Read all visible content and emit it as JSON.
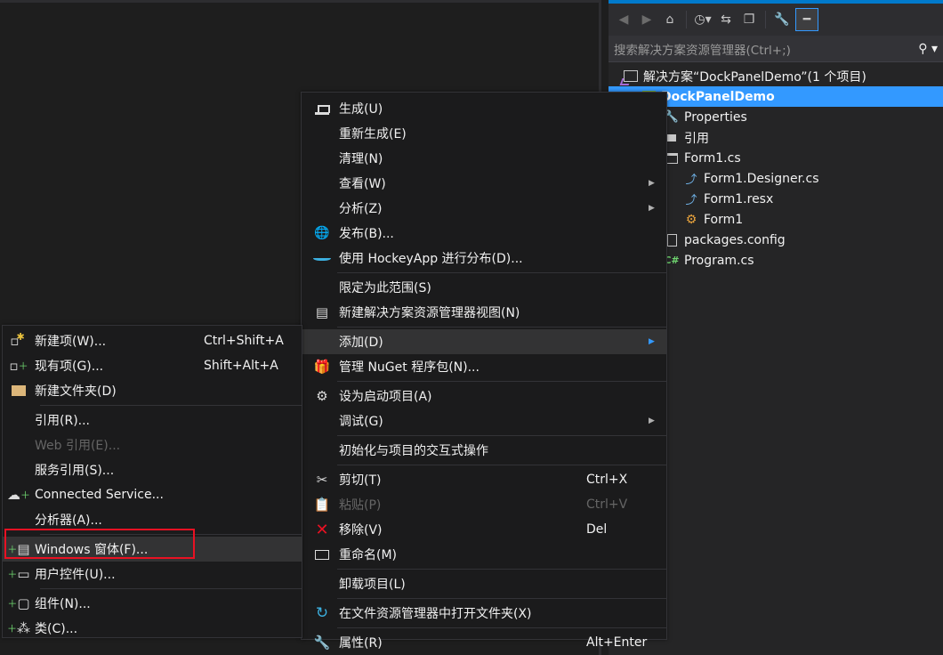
{
  "colors": {
    "accent": "#007acc",
    "selection": "#3399ff",
    "highlight_border": "#e81123"
  },
  "solution_explorer": {
    "toolbar_icons": [
      "back-icon",
      "forward-icon",
      "home-icon",
      "history-icon",
      "sync-icon",
      "collapse-icon",
      "properties-wrench-icon",
      "pin-icon"
    ],
    "search": {
      "placeholder": "搜索解决方案资源管理器(Ctrl+;)"
    },
    "tree": [
      {
        "label": "解决方案“DockPanelDemo”(1 个项目)",
        "icon": "solution-icon",
        "level": 0
      },
      {
        "label": "DockPanelDemo",
        "icon": "csharp-project-icon",
        "level": 1,
        "selected": true
      },
      {
        "label": "Properties",
        "icon": "wrench-icon",
        "level": 2
      },
      {
        "label": "引用",
        "icon": "references-icon",
        "level": 2
      },
      {
        "label": "Form1.cs",
        "icon": "form-icon",
        "level": 2
      },
      {
        "label": "Form1.Designer.cs",
        "icon": "csharp-file-icon",
        "level": 3
      },
      {
        "label": "Form1.resx",
        "icon": "csharp-file-icon",
        "level": 3
      },
      {
        "label": "Form1",
        "icon": "component-icon",
        "level": 3
      },
      {
        "label": "packages.config",
        "icon": "config-file-icon",
        "level": 2
      },
      {
        "label": "Program.cs",
        "icon": "csharp-file-icon",
        "level": 2
      }
    ]
  },
  "context_menu": {
    "items": [
      {
        "label": "生成(U)",
        "icon": "build-icon"
      },
      {
        "label": "重新生成(E)"
      },
      {
        "label": "清理(N)"
      },
      {
        "label": "查看(W)",
        "submenu": true
      },
      {
        "label": "分析(Z)",
        "submenu": true
      },
      {
        "label": "发布(B)...",
        "icon": "publish-globe-icon"
      },
      {
        "label": "使用 HockeyApp 进行分布(D)...",
        "icon": "hockeyapp-icon"
      },
      {
        "label": "限定为此范围(S)"
      },
      {
        "label": "新建解决方案资源管理器视图(N)",
        "icon": "new-view-icon"
      },
      {
        "label": "添加(D)",
        "submenu": true,
        "highlighted": true
      },
      {
        "label": "管理 NuGet 程序包(N)...",
        "icon": "nuget-icon"
      },
      {
        "label": "设为启动项目(A)",
        "icon": "gear-icon"
      },
      {
        "label": "调试(G)",
        "submenu": true
      },
      {
        "label": "初始化与项目的交互式操作"
      },
      {
        "label": "剪切(T)",
        "shortcut": "Ctrl+X",
        "icon": "cut-icon"
      },
      {
        "label": "粘贴(P)",
        "shortcut": "Ctrl+V",
        "icon": "paste-icon",
        "disabled": true
      },
      {
        "label": "移除(V)",
        "shortcut": "Del",
        "icon": "remove-icon"
      },
      {
        "label": "重命名(M)",
        "icon": "rename-icon"
      },
      {
        "label": "卸载项目(L)"
      },
      {
        "label": "在文件资源管理器中打开文件夹(X)",
        "icon": "open-folder-icon"
      },
      {
        "label": "属性(R)",
        "shortcut": "Alt+Enter",
        "icon": "properties-wrench-icon"
      }
    ]
  },
  "add_submenu": {
    "items": [
      {
        "label": "新建项(W)...",
        "shortcut": "Ctrl+Shift+A",
        "icon": "new-item-icon"
      },
      {
        "label": "现有项(G)...",
        "shortcut": "Shift+Alt+A",
        "icon": "existing-item-icon"
      },
      {
        "label": "新建文件夹(D)",
        "icon": "new-folder-icon"
      },
      {
        "label": "引用(R)..."
      },
      {
        "label": "Web 引用(E)...",
        "disabled": true
      },
      {
        "label": "服务引用(S)..."
      },
      {
        "label": "Connected Service...",
        "icon": "connected-service-icon"
      },
      {
        "label": "分析器(A)..."
      },
      {
        "label": "Windows 窗体(F)...",
        "icon": "windows-form-icon",
        "highlighted": true
      },
      {
        "label": "用户控件(U)...",
        "icon": "user-control-icon"
      },
      {
        "label": "组件(N)...",
        "icon": "component-add-icon"
      },
      {
        "label": "类(C)...",
        "icon": "class-icon"
      }
    ]
  }
}
